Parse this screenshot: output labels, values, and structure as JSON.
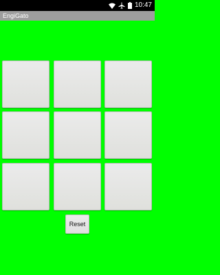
{
  "status_bar": {
    "time": "10:47",
    "icons": [
      "wifi-icon",
      "airplane-mode-icon",
      "battery-icon"
    ]
  },
  "app": {
    "title": "EngiGato"
  },
  "board": {
    "cells": [
      "",
      "",
      "",
      "",
      "",
      "",
      "",
      "",
      ""
    ]
  },
  "controls": {
    "reset_label": "Reset"
  },
  "colors": {
    "background": "#00ff00",
    "status_bar": "#000000",
    "title_bar": "#9e9e9e",
    "cell": "#e4e5e1"
  }
}
